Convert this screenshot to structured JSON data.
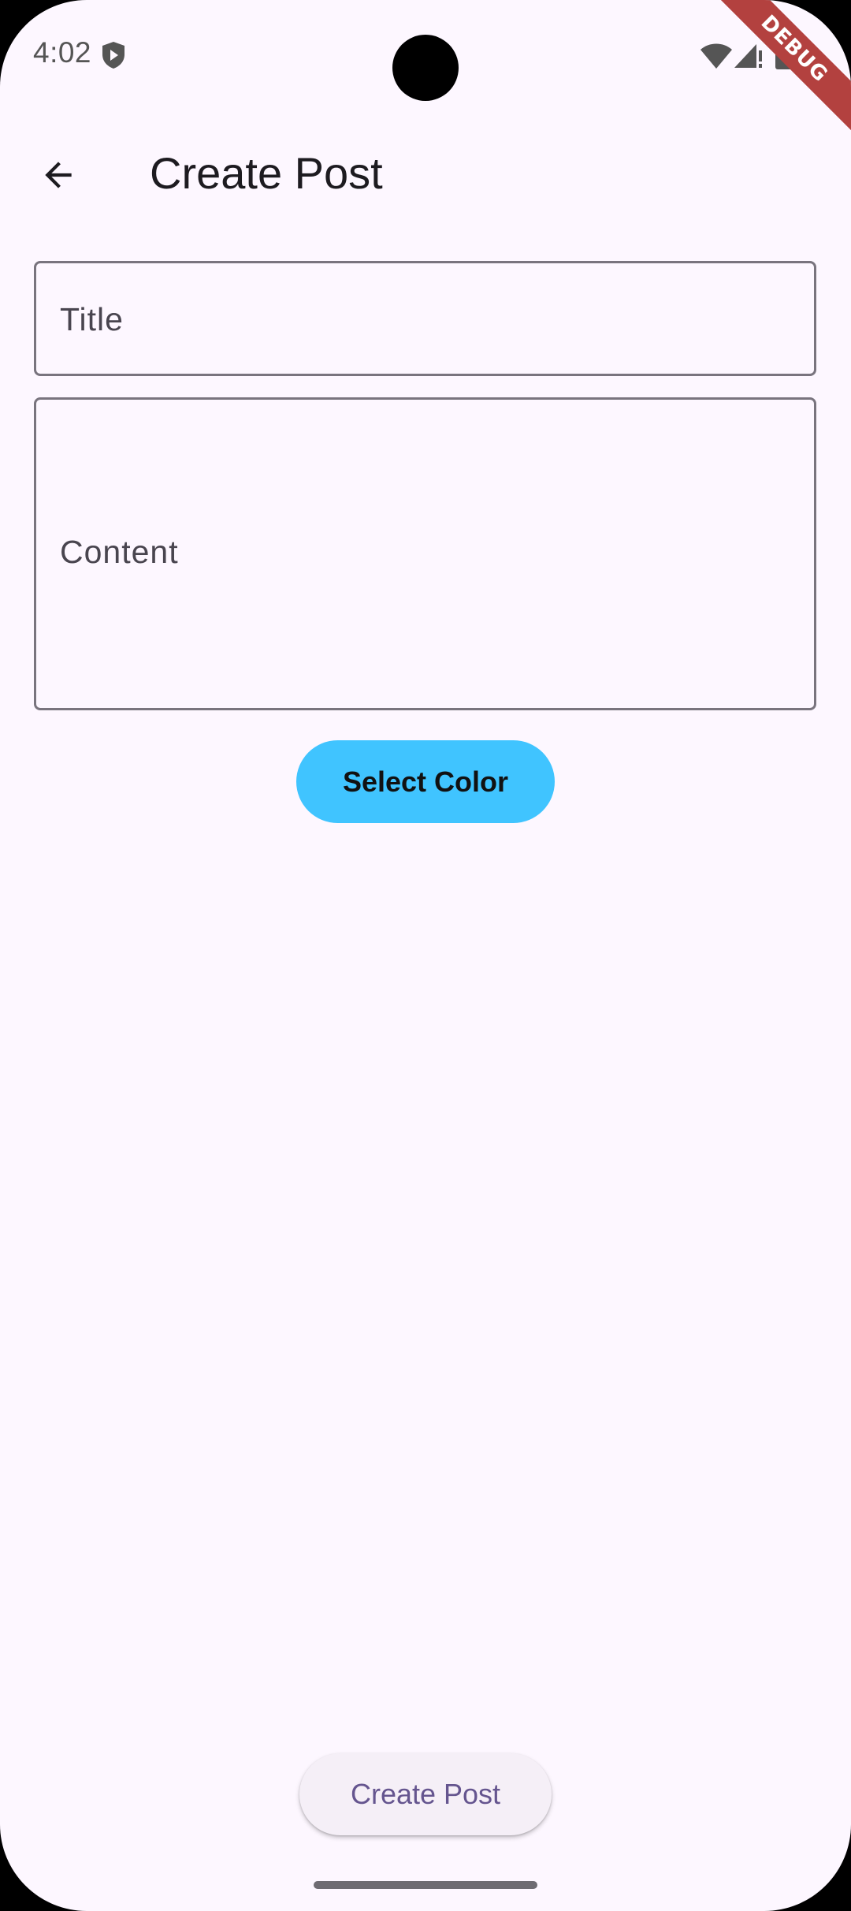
{
  "status_bar": {
    "time": "4:02",
    "debug_label": "DEBUG"
  },
  "app_bar": {
    "title": "Create Post"
  },
  "form": {
    "title_field": {
      "label": "Title",
      "value": ""
    },
    "content_field": {
      "label": "Content",
      "value": ""
    },
    "select_color_label": "Select Color",
    "select_color_button_color": "#40C4FF"
  },
  "footer": {
    "create_post_label": "Create Post"
  },
  "colors": {
    "background": "#FDF7FF",
    "primary_text": "#1D1B20",
    "accent": "#65558F",
    "debug_banner": "#B3413F"
  },
  "icons": {
    "back": "arrow-back-icon",
    "shield": "shield-icon",
    "wifi": "wifi-icon",
    "signal": "signal-icon",
    "battery": "battery-icon"
  }
}
